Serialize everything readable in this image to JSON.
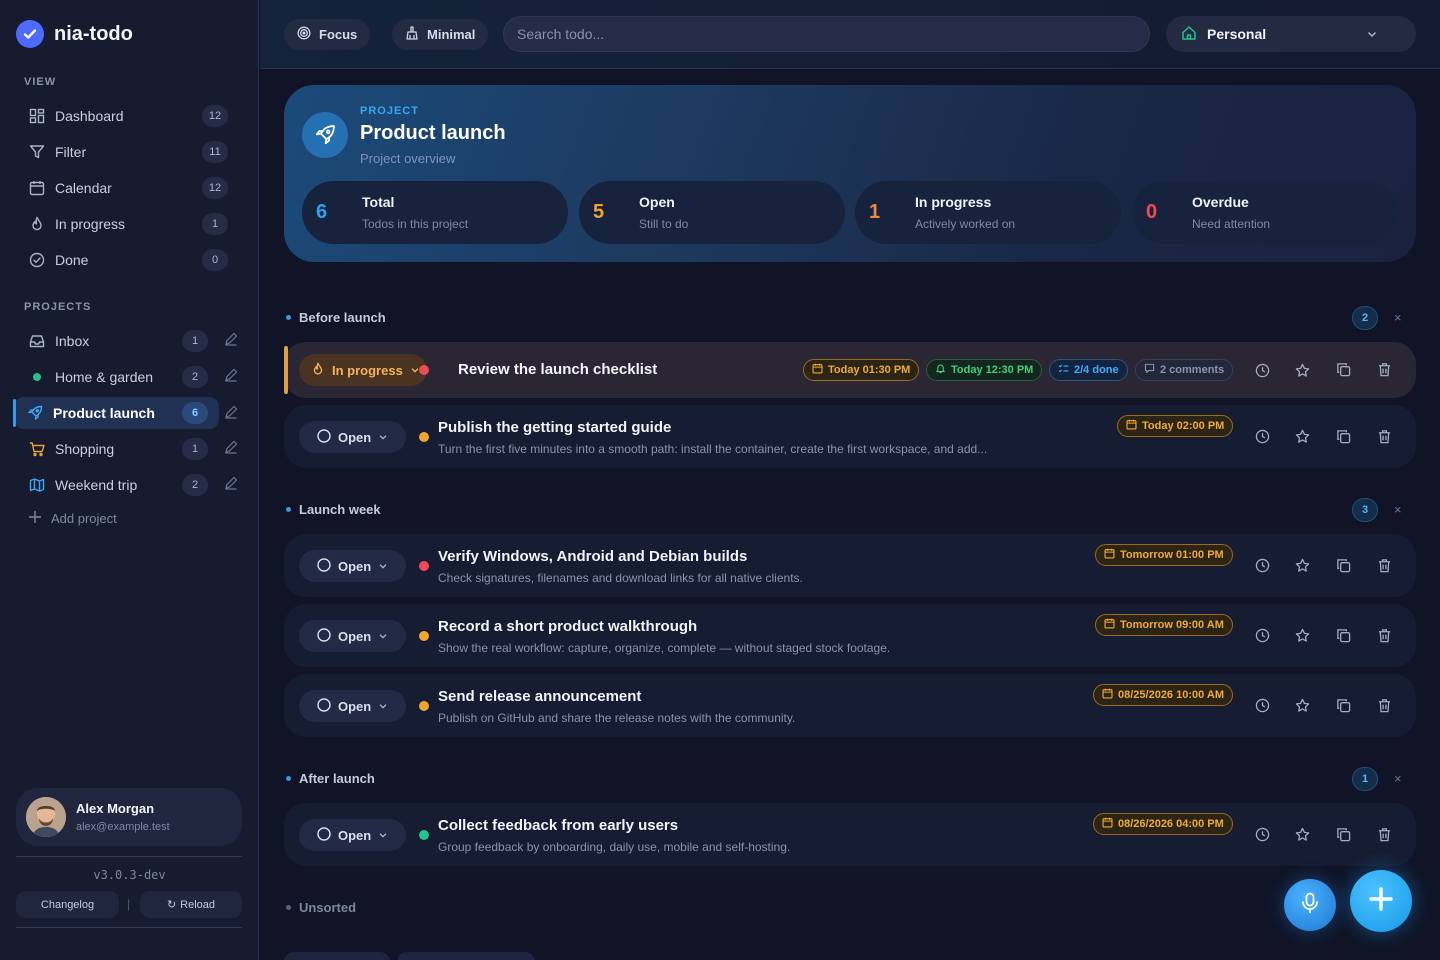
{
  "app": {
    "name": "nia-todo",
    "version": "v3.0.3-dev"
  },
  "sidebar": {
    "view_title": "VIEW",
    "views": [
      {
        "label": "Dashboard",
        "count": "12",
        "icon": "dashboard-icon"
      },
      {
        "label": "Filter",
        "count": "11",
        "icon": "filter-icon"
      },
      {
        "label": "Calendar",
        "count": "12",
        "icon": "calendar-icon"
      },
      {
        "label": "In progress",
        "count": "1",
        "icon": "flame-icon"
      },
      {
        "label": "Done",
        "count": "0",
        "icon": "check-circle-icon"
      }
    ],
    "projects_title": "PROJECTS",
    "projects": [
      {
        "label": "Inbox",
        "count": "1",
        "icon": "inbox-icon"
      },
      {
        "label": "Home & garden",
        "count": "2",
        "icon": "dot-icon"
      },
      {
        "label": "Product launch",
        "count": "6",
        "icon": "rocket-icon",
        "active": true
      },
      {
        "label": "Shopping",
        "count": "1",
        "icon": "cart-icon"
      },
      {
        "label": "Weekend trip",
        "count": "2",
        "icon": "map-icon"
      }
    ],
    "add_project": "Add project",
    "user": {
      "name": "Alex Morgan",
      "email": "alex@example.test"
    },
    "changelog": "Changelog",
    "reload": "Reload"
  },
  "topbar": {
    "focus": "Focus",
    "minimal": "Minimal",
    "search_placeholder": "Search todo...",
    "workspace": "Personal"
  },
  "hero": {
    "kicker": "PROJECT",
    "title": "Product launch",
    "subtitle": "Project overview",
    "stats": [
      {
        "num": "6",
        "label": "Total",
        "desc": "Todos in this project",
        "color": "#2fa3ee"
      },
      {
        "num": "5",
        "label": "Open",
        "desc": "Still to do",
        "color": "#f0a62e"
      },
      {
        "num": "1",
        "label": "In progress",
        "desc": "Actively worked on",
        "color": "#f08a3a"
      },
      {
        "num": "0",
        "label": "Overdue",
        "desc": "Need attention",
        "color": "#ef4b57"
      }
    ]
  },
  "groups": [
    {
      "title": "Before launch",
      "count": "2"
    },
    {
      "title": "Launch week",
      "count": "3"
    },
    {
      "title": "After launch",
      "count": "1"
    },
    {
      "title": "Unsorted"
    }
  ],
  "todos": [
    {
      "status": "In progress",
      "priority_color": "#ef4b57",
      "title": "Review the launch checklist",
      "desc": "",
      "date": "Today 01:30 PM",
      "reminder": "Today 12:30 PM",
      "subtasks": "2/4 done",
      "comments": "2 comments"
    },
    {
      "status": "Open",
      "priority_color": "#f0a62e",
      "title": "Publish the getting started guide",
      "desc": "Turn the first five minutes into a smooth path: install the container, create the first workspace, and add...",
      "date": "Today 02:00 PM"
    },
    {
      "status": "Open",
      "priority_color": "#ef4b57",
      "title": "Verify Windows, Android and Debian builds",
      "desc": "Check signatures, filenames and download links for all native clients.",
      "date": "Tomorrow 01:00 PM"
    },
    {
      "status": "Open",
      "priority_color": "#f0a62e",
      "title": "Record a short product walkthrough",
      "desc": "Show the real workflow: capture, organize, complete — without staged stock footage.",
      "date": "Tomorrow 09:00 AM"
    },
    {
      "status": "Open",
      "priority_color": "#f0a62e",
      "title": "Send release announcement",
      "desc": "Publish on GitHub and share the release notes with the community.",
      "date": "08/25/2026 10:00 AM"
    },
    {
      "status": "Open",
      "priority_color": "#1fc48a",
      "title": "Collect feedback from early users",
      "desc": "Group feedback by onboarding, daily use, mobile and self-hosting.",
      "date": "08/26/2026 04:00 PM"
    }
  ]
}
